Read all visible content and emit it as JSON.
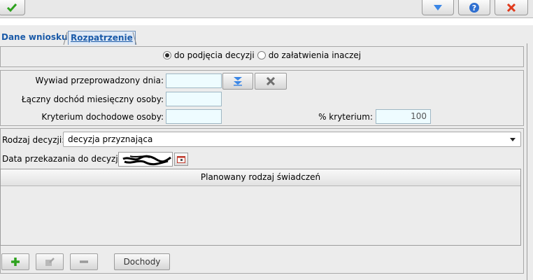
{
  "tabs": [
    {
      "label": "Dane wniosku"
    },
    {
      "label": "Rozpatrzenie"
    }
  ],
  "radio": {
    "option1": "do podjęcia decyzji",
    "option2": "do załatwienia inaczej",
    "selected": "option1"
  },
  "form": {
    "interview_label": "Wywiad przeprowadzony dnia:",
    "interview_value": "",
    "income_label": "Łączny dochód miesięczny osoby:",
    "income_value": "",
    "criterion_label": "Kryterium dochodowe osoby:",
    "criterion_value": "",
    "pct_label": "% kryterium:",
    "pct_value": "100"
  },
  "decision": {
    "type_label": "Rodzaj decyzji:",
    "type_value": "decyzja przyznająca",
    "date_label": "Data przekazania do decyzji:"
  },
  "table": {
    "header": "Planowany rodzaj świadczeń",
    "rows": []
  },
  "bottom": {
    "income_button": "Dochody"
  },
  "colors": {
    "tab_text": "#1a5aa8",
    "input_bg": "#eefcff",
    "accent_green": "#2ea21e",
    "accent_red": "#e03a1c",
    "accent_blue": "#2f6fd0"
  },
  "icons": [
    "check-icon",
    "filter-down-icon",
    "help-icon",
    "close-icon",
    "date-down-icon",
    "clear-icon",
    "calendar-icon",
    "add-icon",
    "edit-icon",
    "remove-icon"
  ]
}
